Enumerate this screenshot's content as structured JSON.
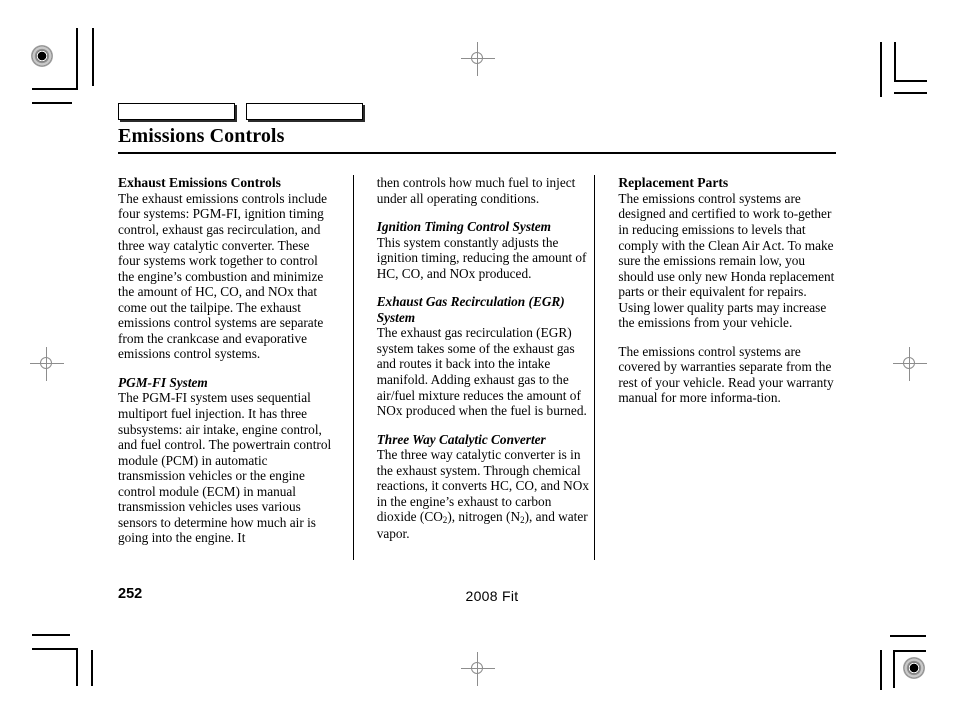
{
  "page": {
    "title": "Emissions Controls",
    "page_number": "252",
    "model_year": "2008  Fit",
    "tabs": [
      "",
      ""
    ]
  },
  "columns": {
    "left": [
      {
        "heading": "Exhaust Emissions Controls",
        "heading_style": "bold",
        "body": "The exhaust emissions controls include four systems: PGM-FI, ignition timing control, exhaust gas recirculation, and three way catalytic converter. These four systems work together to control the engine’s combustion and minimize the amount of HC, CO, and NOx that come out the tailpipe. The exhaust emissions control systems are separate from the crankcase and evaporative emissions control systems."
      },
      {
        "heading": "PGM-FI System",
        "heading_style": "bold-italic",
        "body": "The PGM-FI system uses sequential multiport fuel injection. It has three subsystems: air intake, engine control, and fuel control. The powertrain control module (PCM) in automatic transmission vehicles or the engine control module (ECM) in manual transmission vehicles uses various sensors to determine how much air is going into the engine. It"
      }
    ],
    "middle": [
      {
        "heading": "",
        "heading_style": "none",
        "body": "then controls how much fuel to inject under all operating conditions."
      },
      {
        "heading": "Ignition Timing Control System",
        "heading_style": "bold-italic",
        "body": "This system constantly adjusts the ignition timing, reducing the amount of HC, CO, and NOx produced."
      },
      {
        "heading": "Exhaust Gas Recirculation (EGR) System",
        "heading_style": "bold-italic",
        "body": "The exhaust gas recirculation (EGR) system takes some of the exhaust gas and routes it back into the intake manifold. Adding exhaust gas to the air/fuel mixture reduces the amount of NOx produced when the fuel is burned."
      },
      {
        "heading": "Three Way Catalytic Converter",
        "heading_style": "bold-italic",
        "body_prefix": "The three way catalytic converter is in the exhaust system. Through chemical reactions, it converts HC, CO, and NOx in the engine’s exhaust to carbon dioxide (CO",
        "sub1": "2",
        "body_middle": "), nitrogen (N",
        "sub2": "2",
        "body_suffix": "), and water vapor."
      }
    ],
    "right": [
      {
        "heading": "Replacement Parts",
        "heading_style": "bold",
        "body": "The emissions control systems are designed and certified to work to-gether in reducing emissions to levels that comply with the Clean Air Act. To make sure the emissions remain low, you should use only new Honda replacement parts or their equivalent for repairs. Using lower quality parts may increase the emissions from your vehicle."
      },
      {
        "heading": "",
        "heading_style": "none",
        "body": "The emissions control systems are covered by warranties separate from the rest of your vehicle. Read your warranty manual for more informa-tion."
      }
    ]
  },
  "print_marks": {
    "registration_targets": [
      "bullseye-top-left",
      "bullseye-bottom-right"
    ],
    "crosshairs": [
      "crosshair-top-center",
      "crosshair-left",
      "crosshair-right",
      "crosshair-bottom-center"
    ],
    "crop_marks": [
      "corner-top-left",
      "corner-top-right",
      "corner-bottom-left",
      "corner-bottom-right"
    ]
  }
}
